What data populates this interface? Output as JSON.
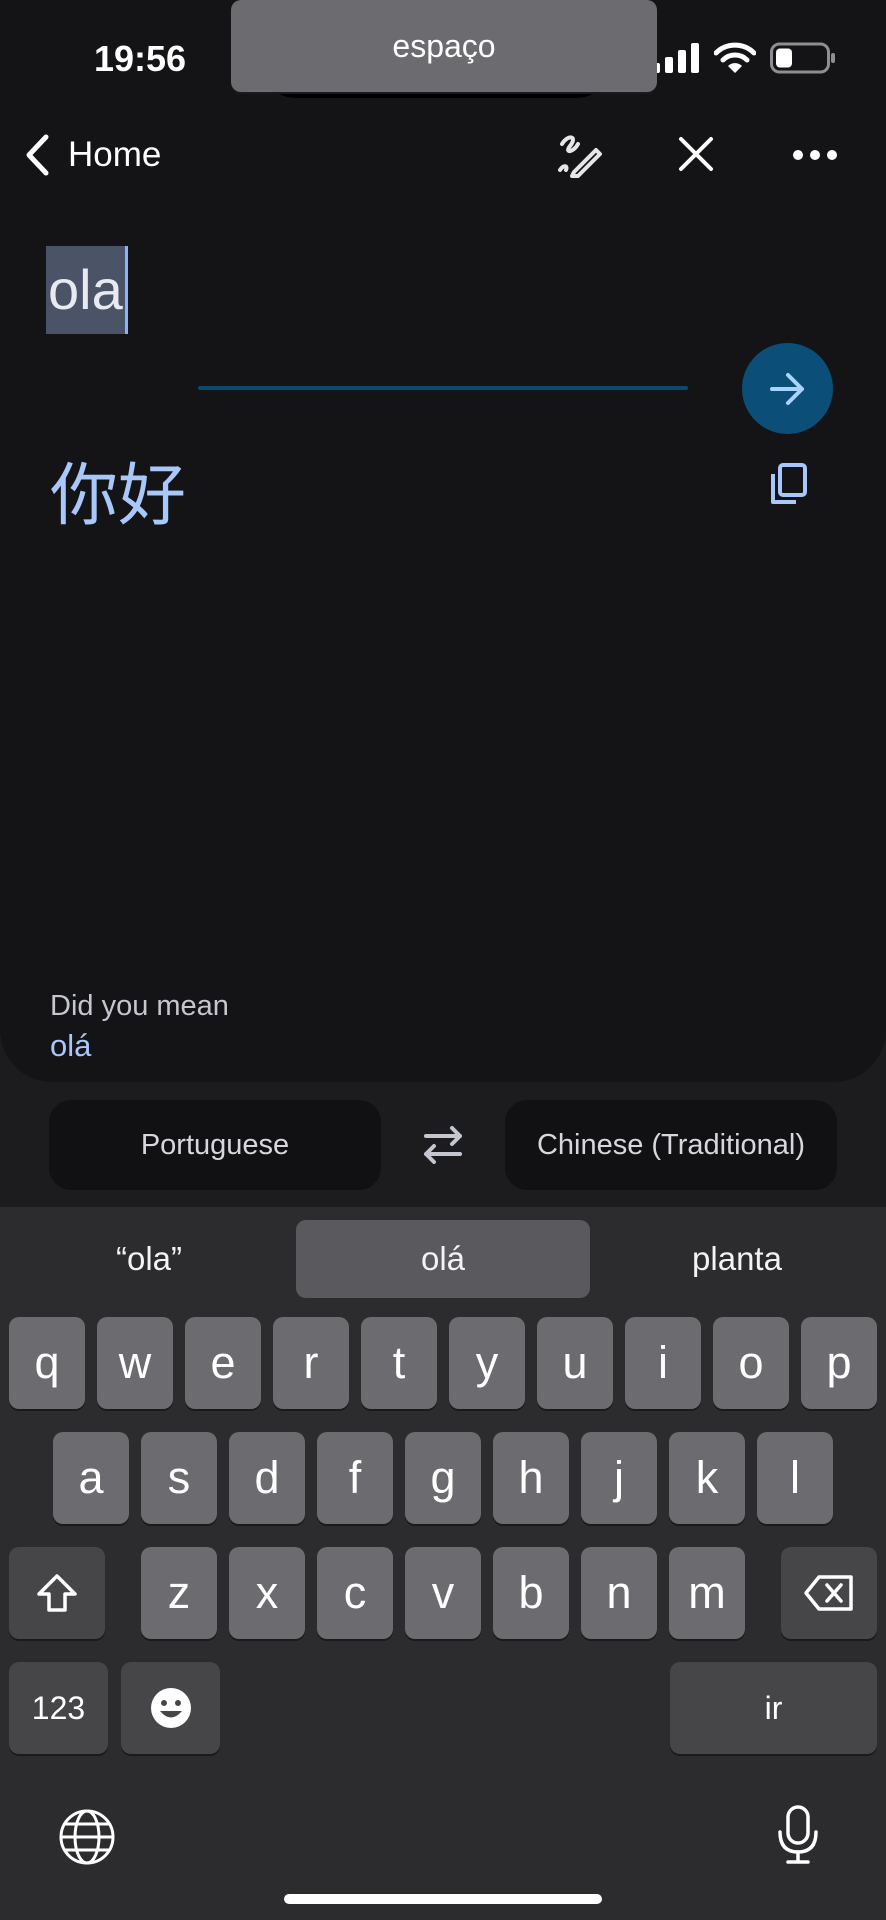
{
  "status": {
    "time": "19:56"
  },
  "nav": {
    "back_label": "Home"
  },
  "input": {
    "text": "ola"
  },
  "output": {
    "text": "你好"
  },
  "did_you_mean": {
    "label": "Did you mean",
    "suggestion": "olá"
  },
  "languages": {
    "source": "Portuguese",
    "target": "Chinese (Traditional)"
  },
  "keyboard": {
    "suggestions": [
      "“ola”",
      "olá",
      "planta"
    ],
    "row1": [
      "q",
      "w",
      "e",
      "r",
      "t",
      "y",
      "u",
      "i",
      "o",
      "p"
    ],
    "row2": [
      "a",
      "s",
      "d",
      "f",
      "g",
      "h",
      "j",
      "k",
      "l"
    ],
    "row3": [
      "z",
      "x",
      "c",
      "v",
      "b",
      "n",
      "m"
    ],
    "numbers_label": "123",
    "space_label": "espaço",
    "return_label": "ir"
  },
  "icons": {
    "back": "chevron-left-icon",
    "handwriting": "handwriting-icon",
    "close": "close-icon",
    "more": "more-horizontal-icon",
    "go": "arrow-right-icon",
    "copy": "copy-icon",
    "swap": "swap-icon",
    "shift": "shift-icon",
    "delete": "backspace-icon",
    "emoji": "emoji-icon",
    "globe": "globe-icon",
    "mic": "microphone-icon"
  },
  "colors": {
    "accent": "#a8c7fa",
    "go_button": "#0b4f78",
    "recording": "#e0343a"
  }
}
